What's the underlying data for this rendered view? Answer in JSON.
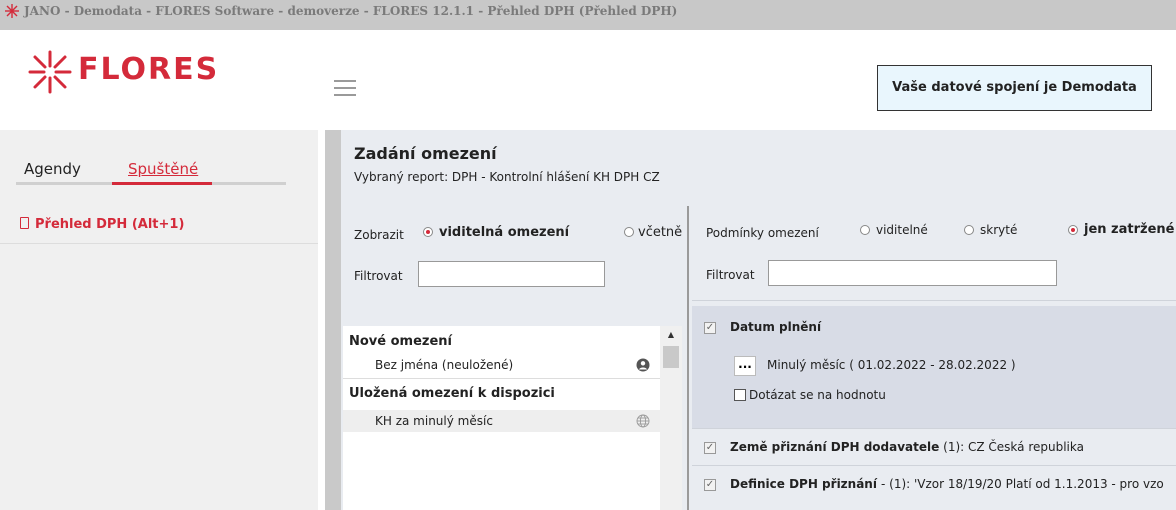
{
  "window": {
    "title": "JANO - Demodata - FLORES Software - demoverze - FLORES 12.1.1 - Přehled DPH  (Přehled DPH)"
  },
  "header": {
    "logo_text": "FLORES",
    "connection": "Vaše datové spojení je Demodata"
  },
  "sidebar": {
    "tabs": [
      {
        "label": "Agendy",
        "active": false
      },
      {
        "label": "Spuštěné",
        "active": true
      }
    ],
    "items": [
      {
        "label": "Přehled DPH (Alt+1)"
      }
    ]
  },
  "main": {
    "title": "Zadání omezení",
    "subtitle": "Vybraný report: DPH - Kontrolní hlášení KH DPH CZ",
    "left": {
      "show_label": "Zobrazit",
      "show_options": [
        {
          "label": "viditelná omezení",
          "selected": true
        },
        {
          "label": "včetně",
          "selected": false
        }
      ],
      "filter_label": "Filtrovat",
      "filter_value": "",
      "list": {
        "groups": [
          {
            "header": "Nové omezení",
            "items": [
              {
                "label": "Bez jména (neuložené)",
                "icon": "user-icon"
              }
            ]
          },
          {
            "header": "Uložená omezení k dispozici",
            "items": [
              {
                "label": "KH za minulý měsíc",
                "icon": "globe-icon"
              }
            ]
          }
        ]
      }
    },
    "right": {
      "conditions_label": "Podmínky omezení",
      "condition_options": [
        {
          "label": "viditelné",
          "selected": false
        },
        {
          "label": "skryté",
          "selected": false
        },
        {
          "label": "jen zatržené",
          "selected": true
        }
      ],
      "filter_label": "Filtrovat",
      "filter_value": "",
      "conditions": [
        {
          "name": "Datum plnění",
          "checked": true,
          "button_label": "...",
          "value": "Minulý měsíc ( 01.02.2022 - 28.02.2022 )",
          "ask_label": "Dotázat se na hodnotu",
          "ask_checked": false
        },
        {
          "name": "Země přiznání DPH dodavatele",
          "checked": true,
          "detail": "- (1): CZ Česká republika"
        },
        {
          "name": "Definice DPH přiznání",
          "checked": true,
          "detail": "- (1): 'Vzor 18/19/20 Platí od 1.1.2013 - pro vzo"
        }
      ]
    }
  },
  "colors": {
    "accent": "#d42a3a",
    "sidebar_bg": "#f0f0f0",
    "main_bg": "#e9ecf1",
    "connection_bg": "#e9f6fd"
  }
}
